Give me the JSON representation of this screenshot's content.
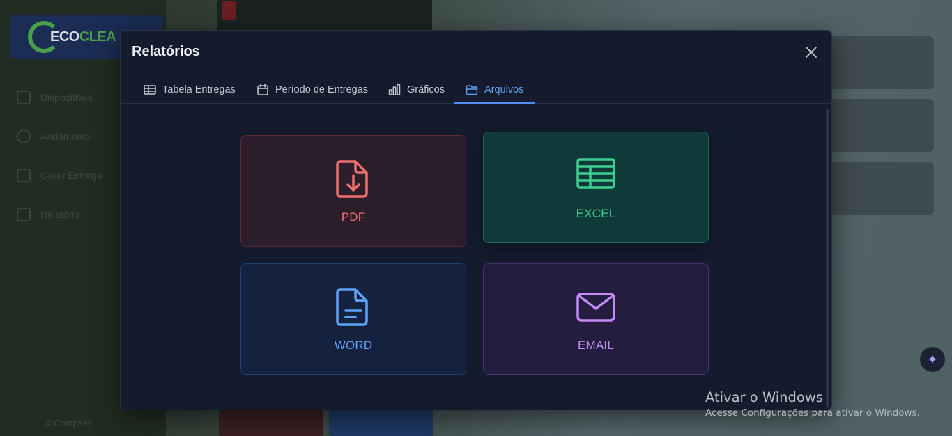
{
  "background": {
    "logo": {
      "part1": "ECO",
      "part2": "CLEA"
    },
    "nav": [
      "Dispositivos",
      "Andamento",
      "Gerar Entrega",
      "Relatório"
    ],
    "footer": "© Compass",
    "fab_icon": "sparkle-icon"
  },
  "modal": {
    "title": "Relatórios",
    "close_icon": "close-icon",
    "tabs": [
      {
        "label": "Tabela Entregas",
        "icon": "table-icon",
        "active": false
      },
      {
        "label": "Período de Entregas",
        "icon": "calendar-icon",
        "active": false
      },
      {
        "label": "Gráficos",
        "icon": "bar-chart-icon",
        "active": false
      },
      {
        "label": "Arquivos",
        "icon": "folder-icon",
        "active": true
      }
    ],
    "export_options": [
      {
        "label": "PDF",
        "icon": "file-download-icon",
        "color": "#ef6f6f"
      },
      {
        "label": "EXCEL",
        "icon": "spreadsheet-icon",
        "color": "#3fd08f"
      },
      {
        "label": "WORD",
        "icon": "document-text-icon",
        "color": "#5fa3f5"
      },
      {
        "label": "EMAIL",
        "icon": "envelope-icon",
        "color": "#c58af5"
      }
    ]
  },
  "watermark": {
    "line1": "Ativar o Windows",
    "line2": "Acesse Configurações para ativar o Windows."
  },
  "colors": {
    "accent": "#4d8ef0",
    "modal_bg": "#141b2d"
  }
}
